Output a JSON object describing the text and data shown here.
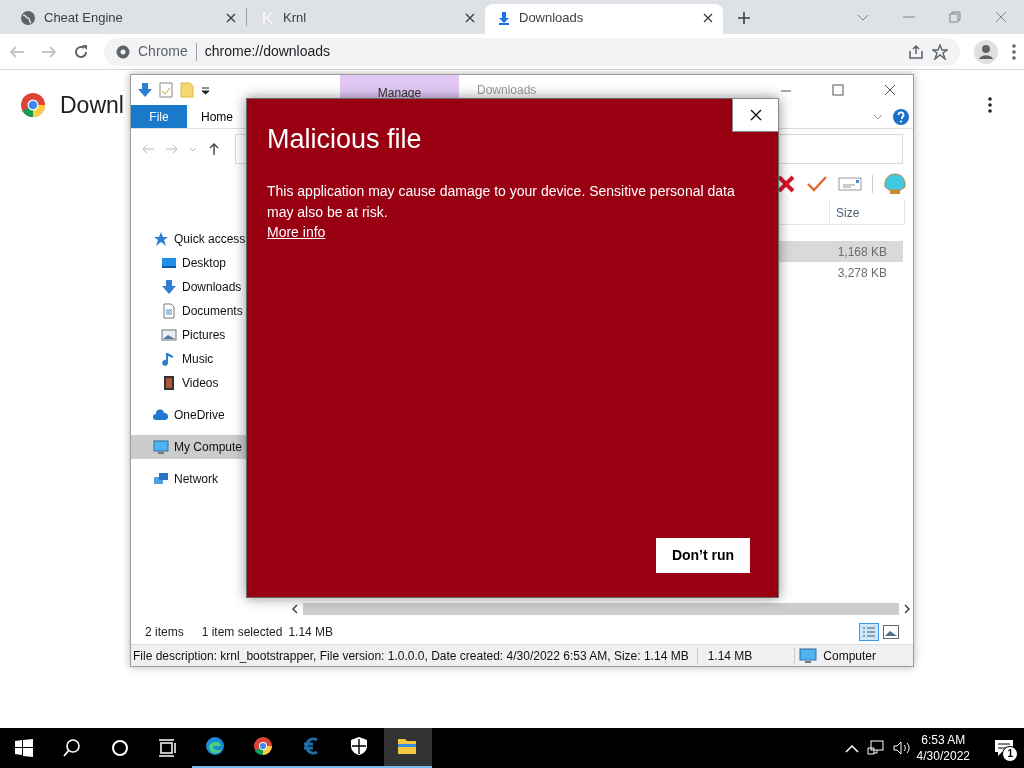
{
  "browser": {
    "tabs": [
      {
        "title": "Cheat Engine",
        "kind": "globe",
        "selected": false
      },
      {
        "title": "Krnl",
        "kind": "krnl",
        "selected": false
      },
      {
        "title": "Downloads",
        "kind": "download",
        "selected": true
      }
    ],
    "omnibox": {
      "site_label": "Chrome",
      "url": "chrome://downloads"
    },
    "page_heading": "Downl"
  },
  "explorer": {
    "context_tab": "Manage",
    "title": "Downloads",
    "ribbon_tabs": [
      {
        "label": "File",
        "kind": "file"
      },
      {
        "label": "Home",
        "kind": "plain"
      }
    ],
    "nav_items": [
      {
        "label": "Quick access",
        "kind": "star",
        "selected": false,
        "children": [
          {
            "label": "Desktop",
            "kind": "desktop",
            "selected": false
          },
          {
            "label": "Downloads",
            "kind": "download",
            "selected": false
          },
          {
            "label": "Documents",
            "kind": "document",
            "selected": false
          },
          {
            "label": "Pictures",
            "kind": "picture",
            "selected": false
          },
          {
            "label": "Music",
            "kind": "music",
            "selected": false
          },
          {
            "label": "Videos",
            "kind": "video",
            "selected": false
          }
        ]
      },
      {
        "label": "OneDrive",
        "kind": "cloud",
        "selected": false
      },
      {
        "label": "My Compute",
        "kind": "computer",
        "selected": true
      },
      {
        "label": "Network",
        "kind": "network",
        "selected": false
      }
    ],
    "size_column": "Size",
    "rows": [
      {
        "size": "1,168 KB",
        "selected": true
      },
      {
        "size": "3,278 KB",
        "selected": false
      }
    ],
    "status": {
      "item_count": "2 items",
      "selection": "1 item selected",
      "selection_size": "1.14 MB"
    },
    "details_bar": {
      "description": "File description: krnl_bootstrapper, File version: 1.0.0.0, Date created: 4/30/2022 6:53 AM, Size: 1.14 MB",
      "size": "1.14 MB",
      "zone": "Computer"
    }
  },
  "dialog": {
    "title": "Malicious file",
    "message": "This application may cause damage to your device. Sensitive personal data may also be at risk.",
    "link": "More info",
    "button": "Don’t run"
  },
  "taskbar": {
    "apps": [
      {
        "kind": "edge",
        "running": true,
        "active": false
      },
      {
        "kind": "chrome",
        "running": true,
        "active": false
      },
      {
        "kind": "cheatengine",
        "running": true,
        "active": false
      },
      {
        "kind": "shield",
        "running": true,
        "active": false
      },
      {
        "kind": "folder",
        "running": true,
        "active": true
      }
    ],
    "time": "6:53 AM",
    "date": "4/30/2022",
    "notification_count": "1"
  }
}
